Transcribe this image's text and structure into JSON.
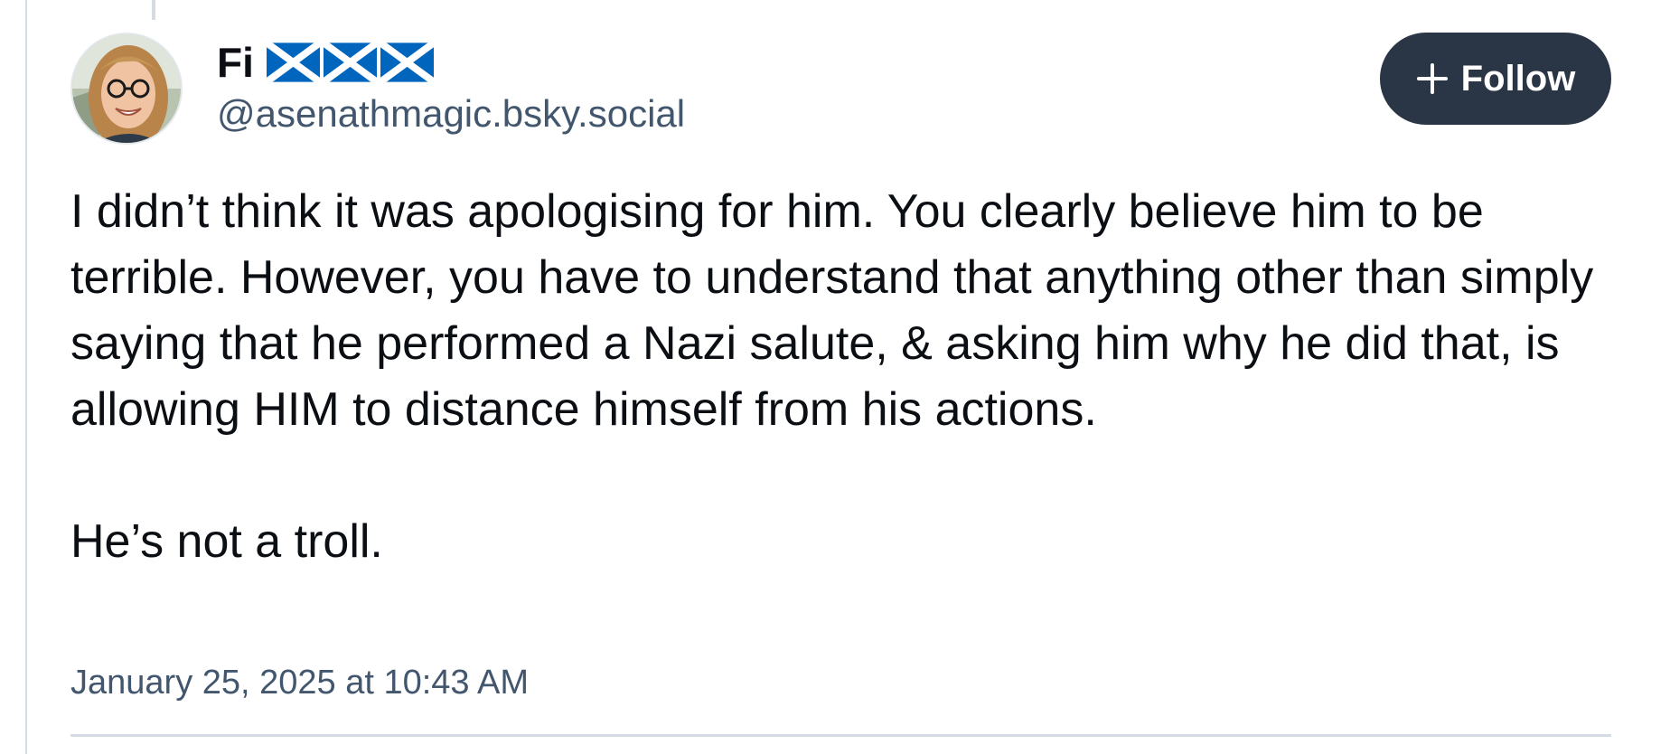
{
  "post": {
    "author": {
      "display_name": "Fi",
      "name_emojis": [
        "scotland-flag",
        "scotland-flag",
        "scotland-flag"
      ],
      "handle": "@asenathmagic.bsky.social",
      "avatar_icon": "profile-photo"
    },
    "follow_button": {
      "label": "Follow",
      "icon": "plus-icon"
    },
    "text": "I didn’t think it was apologising for him. You clearly believe him to be terrible. However, you have to understand that anything other than simply saying that he performed a Nazi salute, & asking him why he did that, is allowing HIM to distance himself from his actions.\n\nHe’s not a troll.",
    "timestamp": "January 25, 2025 at 10:43 AM"
  },
  "colors": {
    "button_bg": "#2a3646",
    "secondary_text": "#42566e",
    "border": "#d4dbe2",
    "flag_blue": "#0065bd"
  }
}
